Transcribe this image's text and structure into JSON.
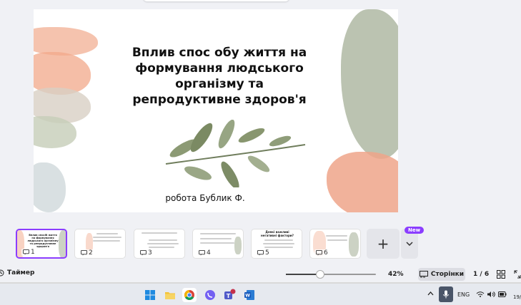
{
  "slide": {
    "title": "Вплив спос обу життя на формування людського організму та репродуктивне здоров'я",
    "subtitle": "робота Бублик Ф."
  },
  "thumbnails": [
    {
      "number": "1",
      "heading": "Вплив спосіб життя на формування людського організму та репродуктивне здоров'я"
    },
    {
      "number": "2",
      "heading": ""
    },
    {
      "number": "3",
      "heading": ""
    },
    {
      "number": "4",
      "heading": ""
    },
    {
      "number": "5",
      "heading": "Деякі важливі негативні фактори?"
    },
    {
      "number": "6",
      "heading": ""
    }
  ],
  "add_page_label": "+",
  "new_badge": "New",
  "controls": {
    "timer_label": "Таймер",
    "zoom_percent": 42,
    "zoom_label": "42%",
    "pages_label": "Сторінки",
    "page_count": "1 / 6"
  },
  "taskbar": {
    "language": "ENG",
    "date": "19/"
  },
  "colors": {
    "accent": "#8b3dff",
    "peach": "#eea589",
    "sage": "#a7b39b"
  }
}
